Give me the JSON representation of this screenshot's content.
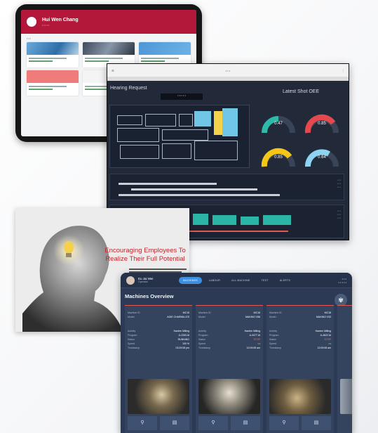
{
  "tablet_app": {
    "user_name": "Hui Wen Chang",
    "user_subtitle": "• • • • •"
  },
  "dashboard": {
    "left_title": "Hearing Request",
    "right_title": "Latest Shot OEE",
    "selector": "• • • • •",
    "gauges": [
      {
        "value": "0.47",
        "color": "#2fb9a8"
      },
      {
        "value": "0.85",
        "color": "#e5484d"
      },
      {
        "value": "0.85",
        "color": "#f5c518"
      },
      {
        "value": "0.64",
        "color": "#8fd3f2"
      }
    ]
  },
  "slide": {
    "title": "Encouraging Employees To Realize Their Full Potential"
  },
  "machine_app": {
    "user_name": "Eu Jai Wei",
    "user_role": "Operator",
    "tabs": [
      "MACHINES",
      "LABOUR",
      "ALL MACHINE",
      "TEST",
      "ALERTS"
    ],
    "time_line1": "• • •",
    "time_line2": "• • • • •",
    "title": "Machines Overview",
    "fab_icon": "pin",
    "cards": [
      {
        "machine_id_label": "Machine ID",
        "machine_id": "MC15",
        "model_label": "Model",
        "model": "AGIE CHARMILLES",
        "activity_label": "Activity",
        "activity": "Harden Milling",
        "program_label": "Program",
        "program": "A-2263 AI",
        "status_label": "Status",
        "status": "RUNNING",
        "speed_label": "Speed",
        "speed": "100 %",
        "timestamp_label": "Timestamp",
        "timestamp": "03:29:08 pm"
      },
      {
        "machine_id_label": "Machine ID",
        "machine_id": "MC16",
        "model_label": "Model",
        "model": "MAKINO V56",
        "activity_label": "Activity",
        "activity": "Harden Milling",
        "program_label": "Program",
        "program": "A-3477 AI",
        "status_label": "Status",
        "status": "STOP",
        "speed_label": "Speed",
        "speed": "• •",
        "timestamp_label": "Timestamp",
        "timestamp": "12:09:08 am"
      },
      {
        "machine_id_label": "Machine ID",
        "machine_id": "MC18",
        "model_label": "Model",
        "model": "MAKINO V33",
        "activity_label": "Activity",
        "activity": "Harden Milling",
        "program_label": "Program",
        "program": "A-4622 AI",
        "status_label": "Status",
        "status": "STOP",
        "speed_label": "Speed",
        "speed": "• •",
        "timestamp_label": "Timestamp",
        "timestamp": "12:09:08 am"
      }
    ]
  }
}
